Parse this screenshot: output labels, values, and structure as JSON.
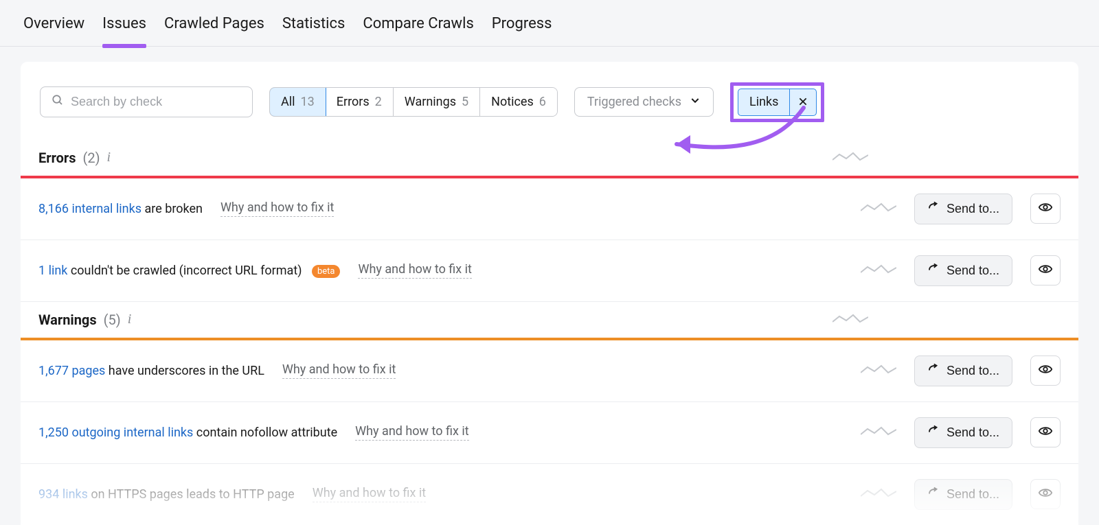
{
  "tabs": {
    "overview": "Overview",
    "issues": "Issues",
    "crawled_pages": "Crawled Pages",
    "statistics": "Statistics",
    "compare_crawls": "Compare Crawls",
    "progress": "Progress",
    "active": "issues"
  },
  "search": {
    "placeholder": "Search by check"
  },
  "filter_seg": {
    "all": {
      "label": "All",
      "count": "13"
    },
    "errors": {
      "label": "Errors",
      "count": "2"
    },
    "warnings": {
      "label": "Warnings",
      "count": "5"
    },
    "notices": {
      "label": "Notices",
      "count": "6"
    }
  },
  "triggered_dropdown": {
    "label": "Triggered checks"
  },
  "filter_chip": {
    "label": "Links"
  },
  "sections": {
    "errors": {
      "title": "Errors",
      "count": "(2)"
    },
    "warnings": {
      "title": "Warnings",
      "count": "(5)"
    }
  },
  "common": {
    "why": "Why and how to fix it",
    "send_to": "Send to...",
    "beta": "beta"
  },
  "rows": {
    "err1": {
      "link": "8,166 internal links",
      "rest": " are broken"
    },
    "err2": {
      "link": "1 link",
      "rest": " couldn't be crawled (incorrect URL format)",
      "beta": true
    },
    "warn1": {
      "link": "1,677 pages",
      "rest": " have underscores in the URL"
    },
    "warn2": {
      "link": "1,250 outgoing internal links",
      "rest": " contain nofollow attribute"
    },
    "warn3": {
      "link": "934 links",
      "rest": " on HTTPS pages leads to HTTP page"
    }
  }
}
